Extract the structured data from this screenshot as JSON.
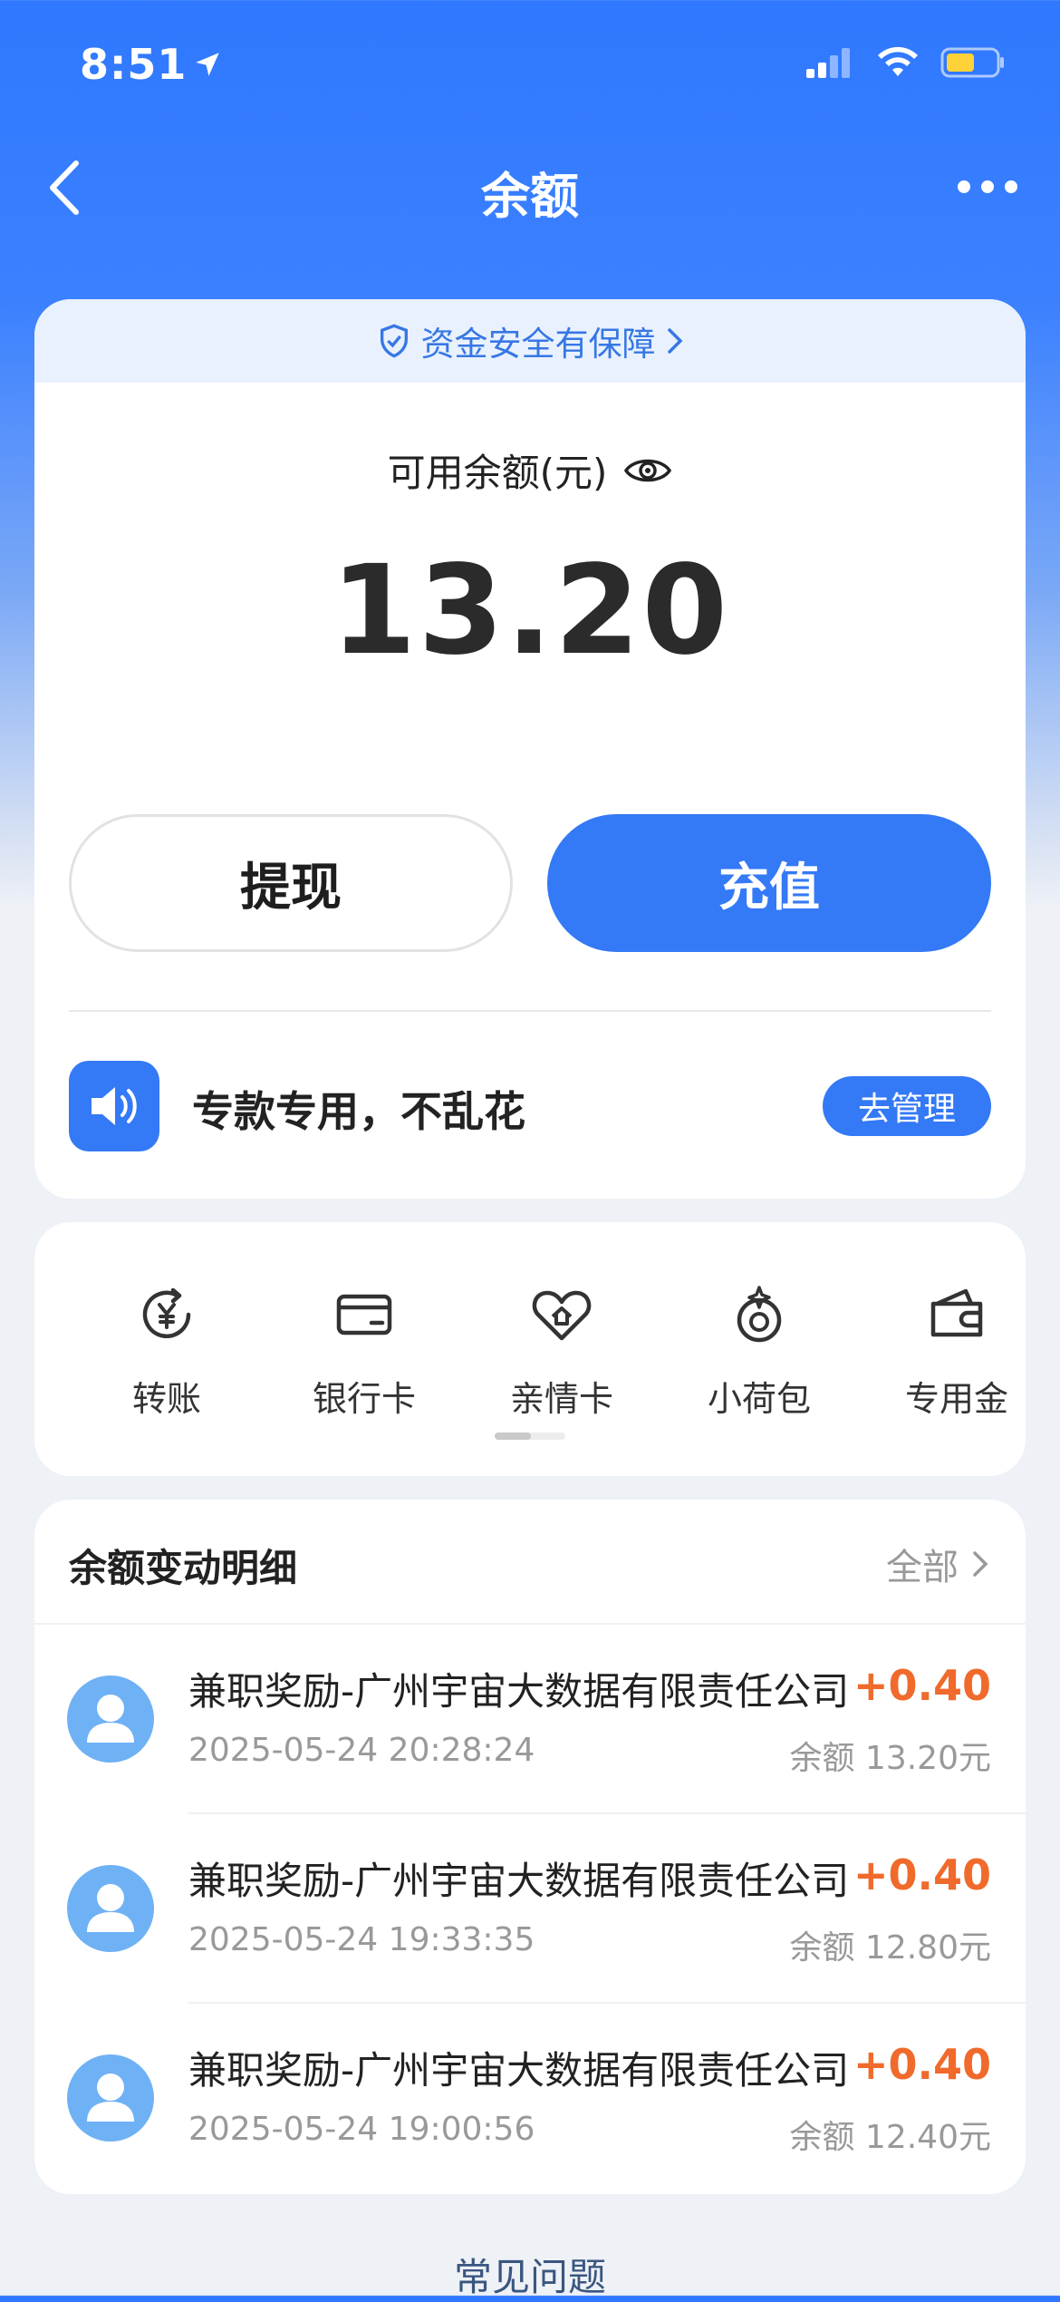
{
  "status_bar": {
    "time": "8:51"
  },
  "nav": {
    "title": "余额"
  },
  "balance_card": {
    "security_banner": "资金安全有保障",
    "label": "可用余额(元)",
    "amount": "13.20",
    "withdraw_label": "提现",
    "recharge_label": "充值",
    "promo_text": "专款专用，不乱花",
    "manage_label": "去管理"
  },
  "actions": [
    {
      "label": "转账",
      "icon": "transfer-icon"
    },
    {
      "label": "银行卡",
      "icon": "bank-card-icon"
    },
    {
      "label": "亲情卡",
      "icon": "family-card-icon"
    },
    {
      "label": "小荷包",
      "icon": "purse-icon"
    },
    {
      "label": "专用金",
      "icon": "wallet-icon"
    }
  ],
  "transactions": {
    "title": "余额变动明细",
    "all_label": "全部",
    "items": [
      {
        "name": "兼职奖励-广州宇宙大数据有限责任公司",
        "amount": "+0.40",
        "time": "2025-05-24 20:28:24",
        "balance": "余额 13.20元"
      },
      {
        "name": "兼职奖励-广州宇宙大数据有限责任公司",
        "amount": "+0.40",
        "time": "2025-05-24 19:33:35",
        "balance": "余额 12.80元"
      },
      {
        "name": "兼职奖励-广州宇宙大数据有限责任公司",
        "amount": "+0.40",
        "time": "2025-05-24 19:00:56",
        "balance": "余额 12.40元"
      }
    ]
  },
  "footer": {
    "faq_label": "常见问题"
  },
  "colors": {
    "primary": "#3479f6",
    "amount_positive": "#f06a2b",
    "avatar": "#6fb1f5"
  }
}
